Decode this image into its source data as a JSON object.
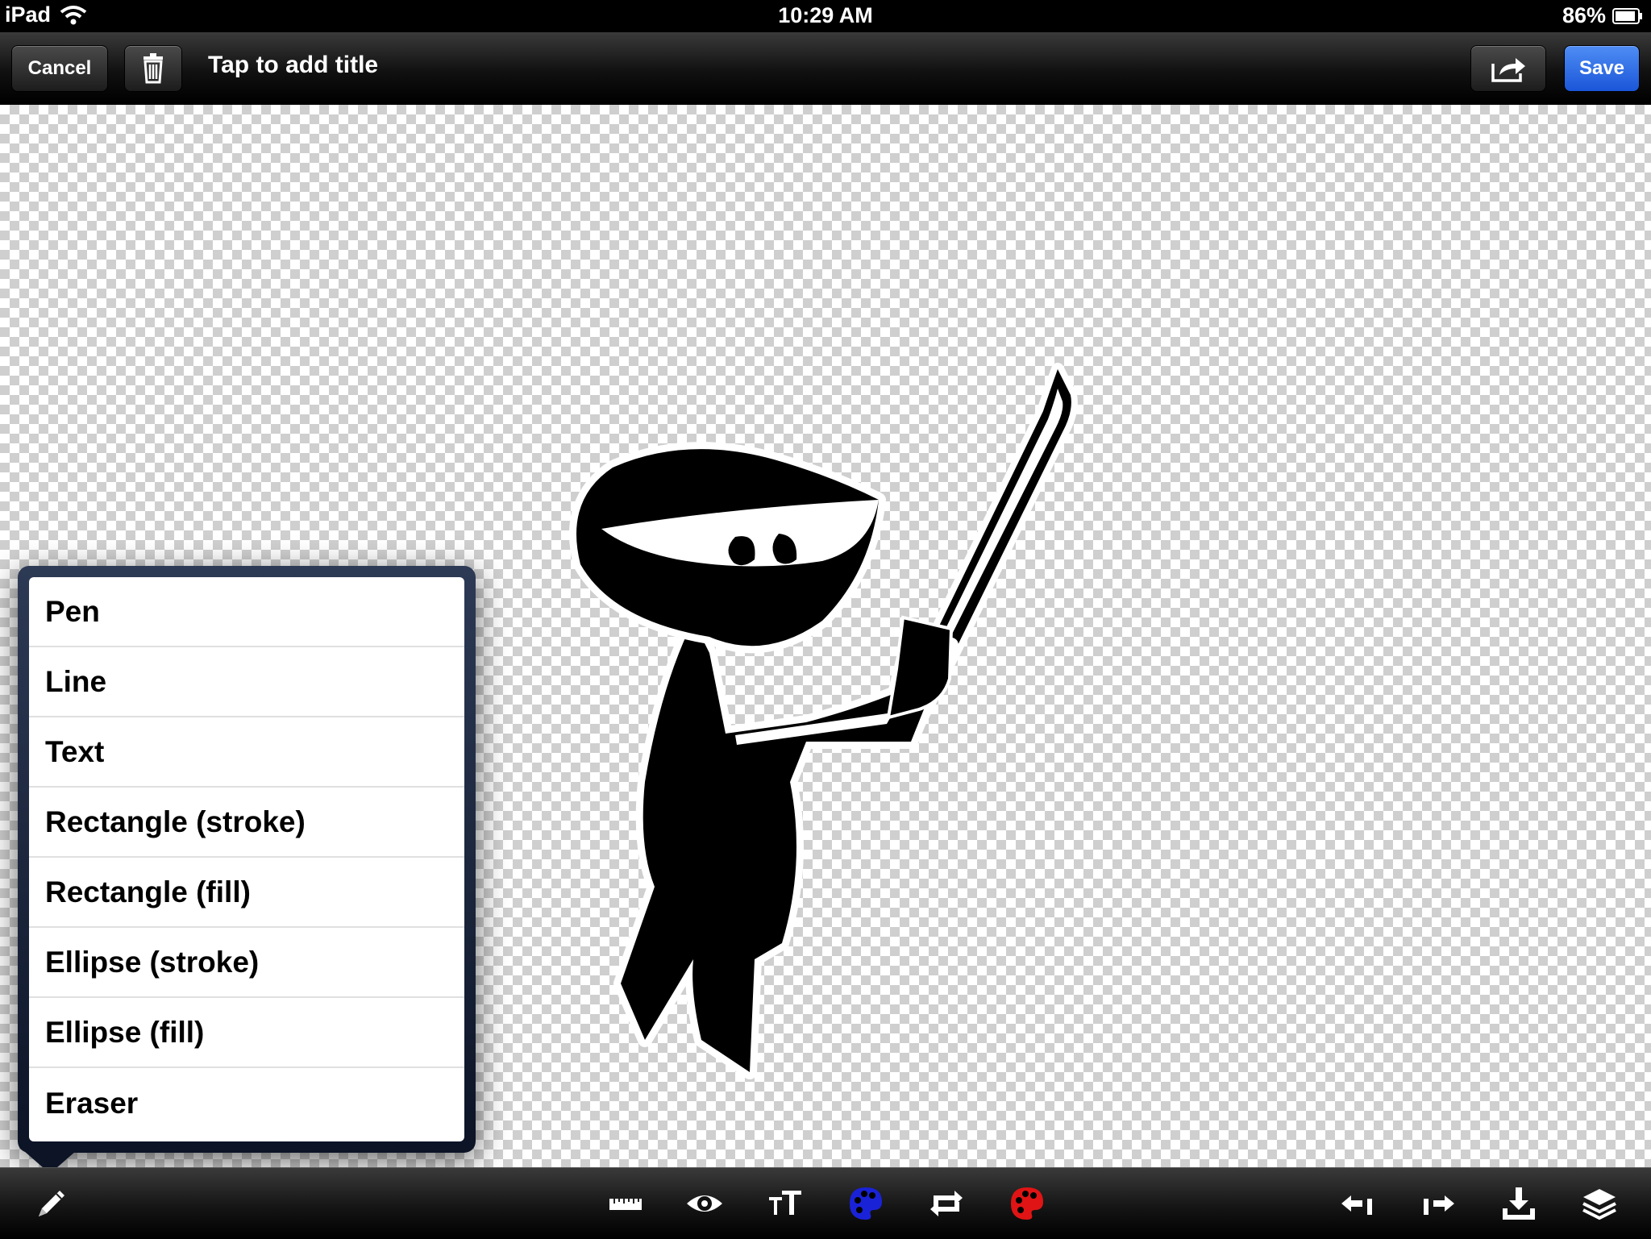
{
  "status_bar": {
    "device": "iPad",
    "time": "10:29 AM",
    "battery_percent": "86%"
  },
  "toolbar": {
    "cancel_label": "Cancel",
    "title_placeholder": "Tap to add title",
    "save_label": "Save",
    "icons": [
      "trash-icon",
      "share-icon"
    ],
    "save_color": "#2a6ae8"
  },
  "tool_menu": {
    "items": [
      {
        "label": "Pen"
      },
      {
        "label": "Line"
      },
      {
        "label": "Text"
      },
      {
        "label": "Rectangle (stroke)"
      },
      {
        "label": "Rectangle (fill)"
      },
      {
        "label": "Ellipse (stroke)"
      },
      {
        "label": "Ellipse (fill)"
      },
      {
        "label": "Eraser"
      }
    ]
  },
  "bottom_toolbar": {
    "icons": [
      "pencil-icon",
      "ruler-icon",
      "eye-icon",
      "text-size-icon",
      "palette-blue-icon",
      "flip-icon",
      "palette-red-icon",
      "undo-icon",
      "redo-icon",
      "download-icon",
      "layers-icon"
    ],
    "primary_color": "#1a22d8",
    "secondary_color": "#e01414"
  },
  "canvas": {
    "background": "transparent-checkerboard",
    "content": "ninja-drawing"
  }
}
